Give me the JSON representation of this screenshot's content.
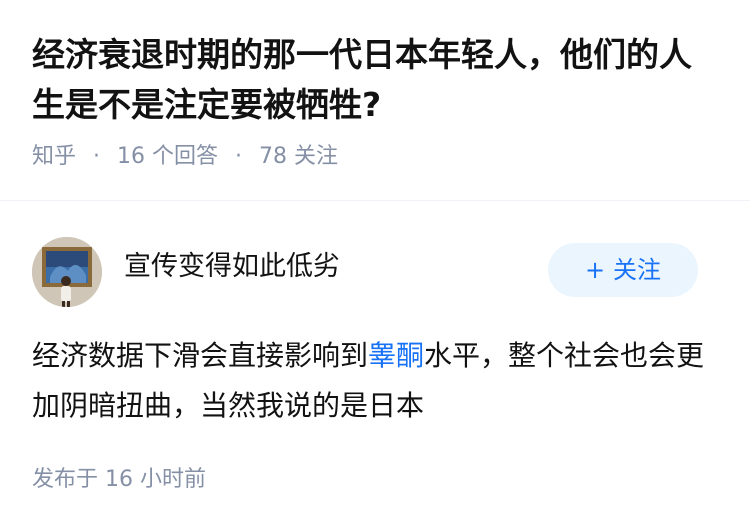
{
  "question": {
    "title": "经济衰退时期的那一代日本年轻人，他们的人生是不是注定要被牺牲?",
    "source": "知乎",
    "answer_count": "16 个回答",
    "follower_count": "78 关注",
    "separator": "·"
  },
  "answer": {
    "author_name": "宣传变得如此低劣",
    "follow_button": {
      "icon": "plus-icon",
      "label": "关注",
      "plus": "+"
    },
    "content_before_link": "经济数据下滑会直接影响到",
    "content_link": "睾酮",
    "content_after_link": "水平，整个社会也会更加阴暗扭曲，当然我说的是日本",
    "publish_time": "发布于 16 小时前"
  },
  "colors": {
    "title": "#121212",
    "meta": "#8590a6",
    "accent": "#1772f6",
    "follow_bg": "#ebf5fd"
  }
}
